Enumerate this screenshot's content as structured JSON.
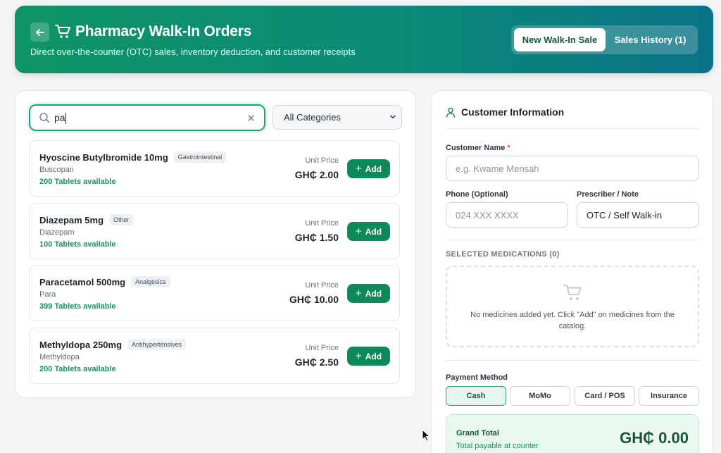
{
  "header": {
    "title": "Pharmacy Walk-In Orders",
    "subtitle": "Direct over-the-counter (OTC) sales, inventory deduction, and customer receipts",
    "tabs": [
      {
        "label": "New Walk-In Sale",
        "active": true
      },
      {
        "label": "Sales History (1)",
        "active": false
      }
    ]
  },
  "catalog": {
    "search_value": "pa",
    "category_select": "All Categories",
    "price_label": "Unit Price",
    "add_label": "Add",
    "products": [
      {
        "name": "Hyoscine Butylbromide 10mg",
        "category": "Gastrointestinal",
        "brand": "Buscopan",
        "stock": "200 Tablets available",
        "price": "GH₵ 2.00"
      },
      {
        "name": "Diazepam 5mg",
        "category": "Other",
        "brand": "Diazepam",
        "stock": "100 Tablets available",
        "price": "GH₵ 1.50"
      },
      {
        "name": "Paracetamol 500mg",
        "category": "Analgesics",
        "brand": "Para",
        "stock": "399 Tablets available",
        "price": "GH₵ 10.00"
      },
      {
        "name": "Methyldopa 250mg",
        "category": "Antihypertensives",
        "brand": "Methyldopa",
        "stock": "200 Tablets available",
        "price": "GH₵ 2.50"
      }
    ]
  },
  "customer": {
    "title": "Customer Information",
    "name_label": "Customer Name",
    "name_required_mark": "*",
    "name_placeholder": "e.g. Kwame Mensah",
    "phone_label": "Phone (Optional)",
    "phone_placeholder": "024 XXX XXXX",
    "prescriber_label": "Prescriber / Note",
    "prescriber_value": "OTC / Self Walk-in",
    "selected_label": "SELECTED MEDICATIONS (0)",
    "empty_text": "No medicines added yet. Click \"Add\" on medicines from the catalog.",
    "payment_label": "Payment Method",
    "payment_methods": [
      "Cash",
      "MoMo",
      "Card / POS",
      "Insurance"
    ],
    "payment_selected": "Cash",
    "grand_total_label": "Grand Total",
    "grand_total_sub": "Total payable at counter",
    "grand_total_value": "GH₵ 0.00"
  },
  "colors": {
    "brand_green": "#0f9466",
    "brand_teal": "#0b7288",
    "accent": "#0d8a58",
    "stock_green": "#16935f",
    "required_red": "#e04848"
  }
}
